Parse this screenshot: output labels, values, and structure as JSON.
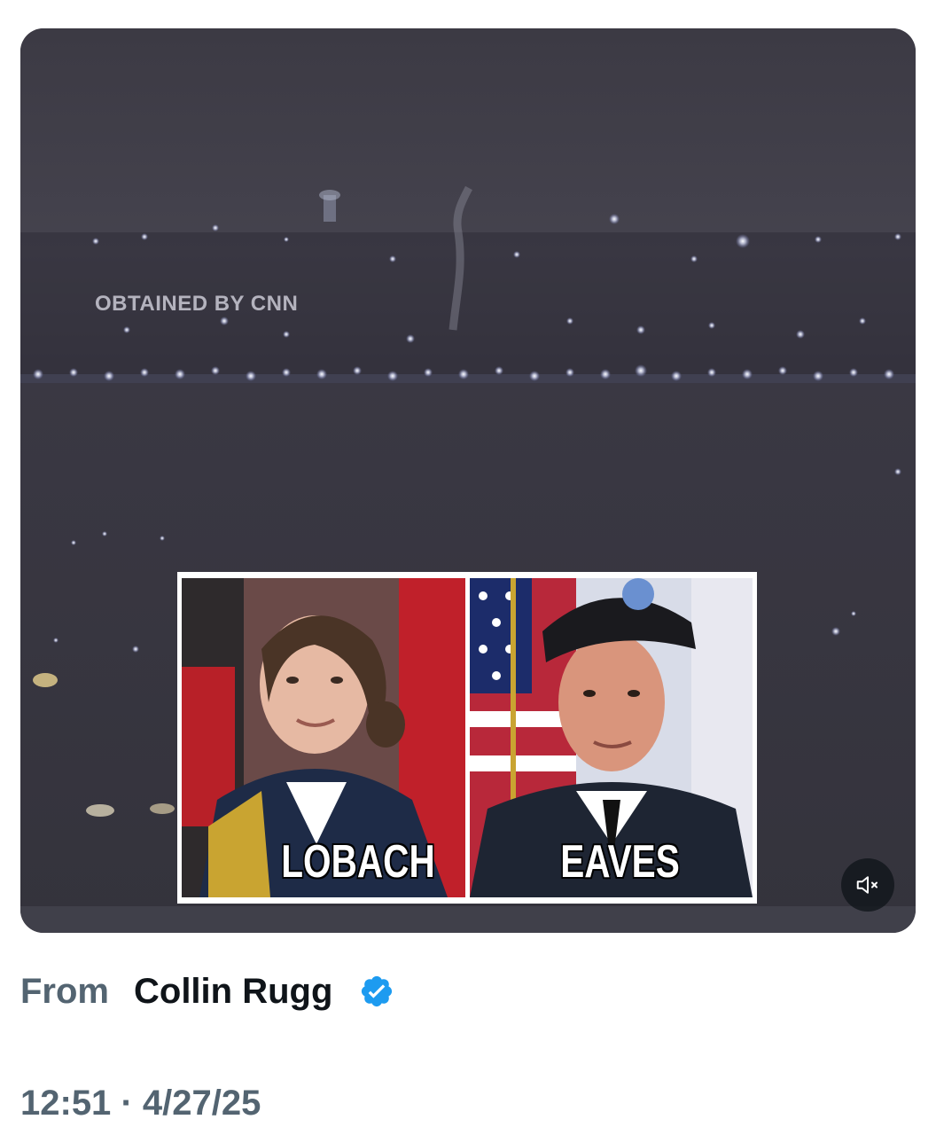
{
  "media": {
    "watermark": "OBTAINED BY CNN",
    "photos": [
      {
        "caption": "LOBACH"
      },
      {
        "caption": "EAVES"
      }
    ],
    "mute_icon": "speaker-muted-icon"
  },
  "source": {
    "from_label": "From",
    "author_name": "Collin Rugg",
    "verified_icon": "verified-badge-icon",
    "badge_color": "#1d9bf0"
  },
  "timestamp": {
    "time": "12:51",
    "separator": "·",
    "date": "4/27/25"
  }
}
